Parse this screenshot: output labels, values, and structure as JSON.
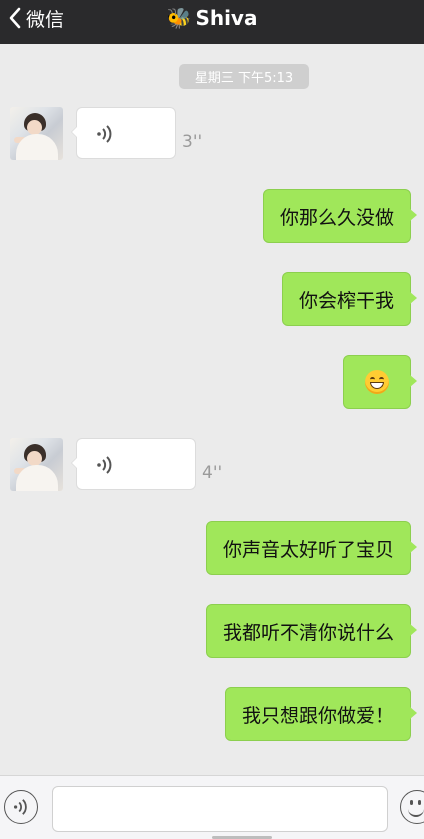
{
  "navbar": {
    "back_label": "微信",
    "title": "Shiva",
    "title_emoji": "🐝"
  },
  "timestamp": "星期三 下午5:13",
  "messages": [
    {
      "type": "voice",
      "side": "left",
      "duration": "3''"
    },
    {
      "type": "text",
      "side": "right",
      "text": "你那么久没做"
    },
    {
      "type": "text",
      "side": "right",
      "text": "你会榨干我"
    },
    {
      "type": "emoji",
      "side": "right",
      "emoji": "smiling-face-icon"
    },
    {
      "type": "voice",
      "side": "left",
      "duration": "4''"
    },
    {
      "type": "text",
      "side": "right",
      "text": "你声音太好听了宝贝"
    },
    {
      "type": "text",
      "side": "right",
      "text": "我都听不清你说什么"
    },
    {
      "type": "text",
      "side": "right",
      "text": "我只想跟你做爱！"
    }
  ],
  "input": {
    "value": "",
    "placeholder": ""
  },
  "colors": {
    "navbar": "#2a2a2c",
    "background": "#ebebeb",
    "sent_bubble": "#a0e75a",
    "received_bubble": "#ffffff",
    "timestamp_pill": "#cfcfcf"
  }
}
